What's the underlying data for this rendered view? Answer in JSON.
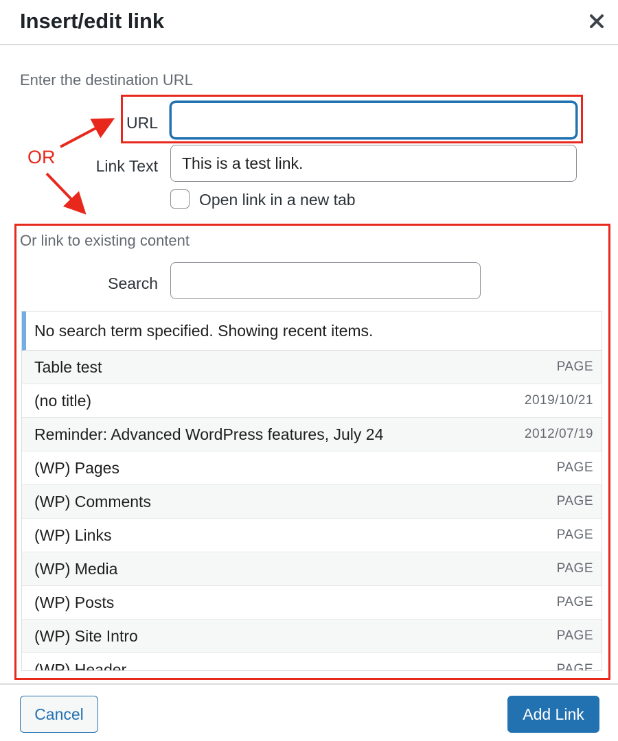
{
  "dialog": {
    "title": "Insert/edit link",
    "close_icon": "close-icon"
  },
  "url_section": {
    "heading": "Enter the destination URL",
    "url_label": "URL",
    "url_value": "",
    "link_text_label": "Link Text",
    "link_text_value": "This is a test link.",
    "new_tab_label": "Open link in a new tab",
    "new_tab_checked": false
  },
  "annotation": {
    "or_label": "OR",
    "color": "#e8281c"
  },
  "existing_content": {
    "heading": "Or link to existing content",
    "search_label": "Search",
    "search_value": "",
    "notice": "No search term specified. Showing recent items.",
    "items": [
      {
        "title": "Table test",
        "info": "PAGE"
      },
      {
        "title": "(no title)",
        "info": "2019/10/21"
      },
      {
        "title": "Reminder: Advanced WordPress features, July 24",
        "info": "2012/07/19"
      },
      {
        "title": "(WP) Pages",
        "info": "PAGE"
      },
      {
        "title": "(WP) Comments",
        "info": "PAGE"
      },
      {
        "title": "(WP) Links",
        "info": "PAGE"
      },
      {
        "title": "(WP) Media",
        "info": "PAGE"
      },
      {
        "title": "(WP) Posts",
        "info": "PAGE"
      },
      {
        "title": "(WP) Site Intro",
        "info": "PAGE"
      },
      {
        "title": "(WP) Header",
        "info": "PAGE"
      }
    ]
  },
  "footer": {
    "cancel_label": "Cancel",
    "add_link_label": "Add Link"
  },
  "colors": {
    "primary": "#2271b1",
    "notice_accent": "#72aee6",
    "annotation": "#e8281c"
  }
}
